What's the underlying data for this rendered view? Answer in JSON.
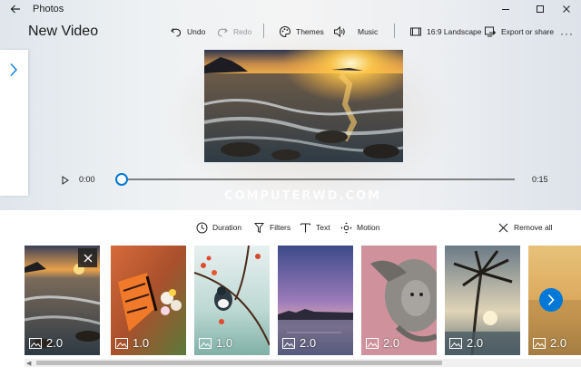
{
  "window": {
    "app_title": "Photos"
  },
  "page": {
    "title": "New Video"
  },
  "toolbar": {
    "undo": "Undo",
    "redo": "Redo",
    "themes": "Themes",
    "music": "Music",
    "aspect": "16:9 Landscape",
    "export": "Export or share",
    "more": "···"
  },
  "player": {
    "time_start": "0:00",
    "time_end": "0:15",
    "progress": 0
  },
  "watermark": "COMPUTERWD.COM",
  "edit_bar": {
    "duration": "Duration",
    "filters": "Filters",
    "text": "Text",
    "motion": "Motion",
    "remove_all": "Remove all"
  },
  "storyboard": {
    "cards": [
      {
        "duration": "2.0",
        "selected": true
      },
      {
        "duration": "1.0"
      },
      {
        "duration": "1.0"
      },
      {
        "duration": "2.0"
      },
      {
        "duration": "2.0"
      },
      {
        "duration": "2.0"
      },
      {
        "duration": "2.0"
      }
    ]
  },
  "colors": {
    "accent": "#0078d7"
  }
}
